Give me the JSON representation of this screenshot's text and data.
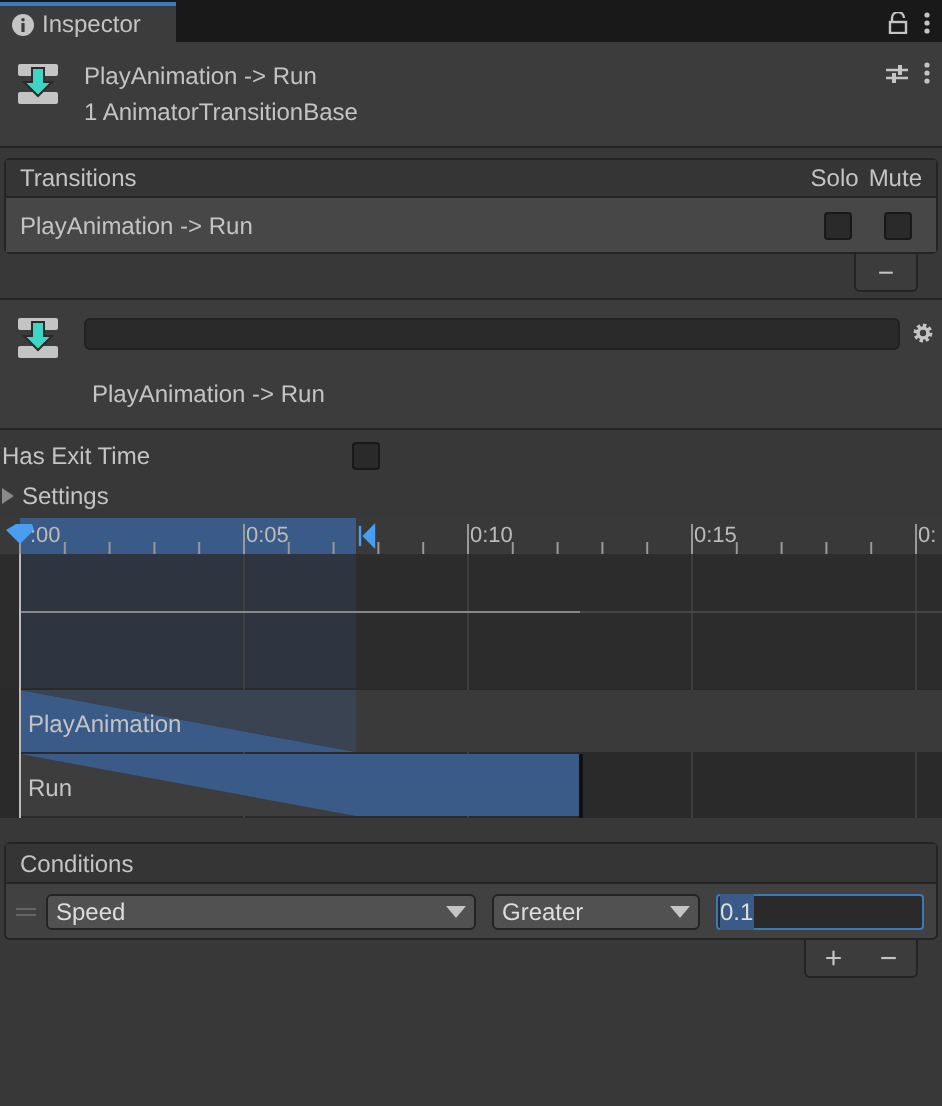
{
  "tab": {
    "label": "Inspector",
    "selected": true
  },
  "header": {
    "title": "PlayAnimation -> Run",
    "subtitle": "1 AnimatorTransitionBase"
  },
  "transitions": {
    "title": "Transitions",
    "columns": [
      "Solo",
      "Mute"
    ],
    "rows": [
      {
        "name": "PlayAnimation -> Run",
        "solo": false,
        "mute": false
      }
    ],
    "remove_label": "−"
  },
  "transition": {
    "caption": "PlayAnimation -> Run"
  },
  "has_exit_time": {
    "label": "Has Exit Time",
    "checked": false
  },
  "settings": {
    "label": "Settings",
    "expanded": false
  },
  "timeline": {
    "ticks": [
      ":00",
      "0:05",
      "0:10",
      "0:15",
      "0:"
    ],
    "tracks": [
      {
        "name": "PlayAnimation"
      },
      {
        "name": "Run"
      }
    ]
  },
  "conditions": {
    "title": "Conditions",
    "rows": [
      {
        "parameter": "Speed",
        "mode": "Greater",
        "value": "0.1",
        "value_selected": true
      }
    ],
    "add_label": "+",
    "remove_label": "−"
  }
}
